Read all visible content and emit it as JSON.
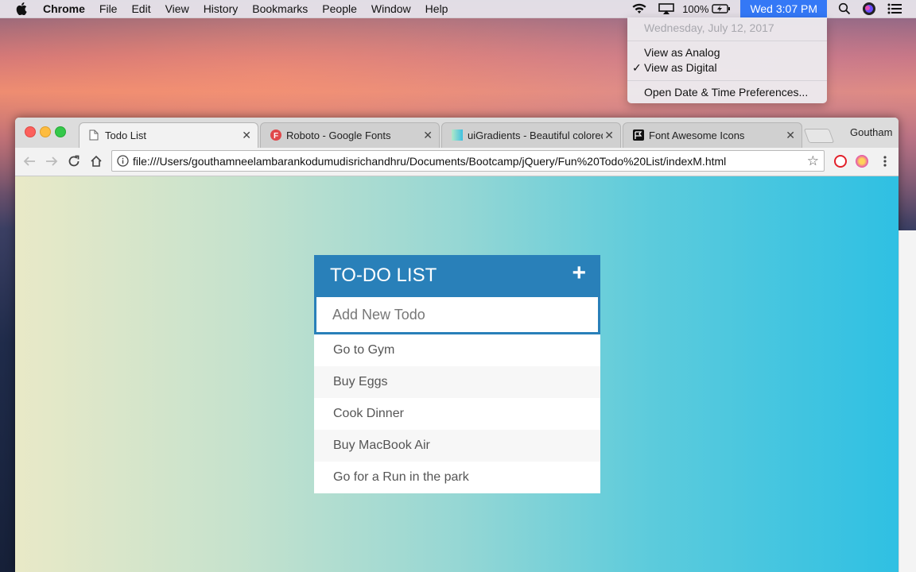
{
  "menubar": {
    "app_name": "Chrome",
    "menus": [
      "File",
      "Edit",
      "View",
      "History",
      "Bookmarks",
      "People",
      "Window",
      "Help"
    ],
    "battery": "100%",
    "clock": "Wed 3:07 PM",
    "icons": [
      "wifi-icon",
      "airplay-icon",
      "battery-icon",
      "spotlight-icon",
      "siri-icon",
      "notification-center-icon"
    ]
  },
  "clock_menu": {
    "date": "Wednesday, July 12, 2017",
    "view_analog": "View as Analog",
    "view_digital": "View as Digital",
    "check": "✓",
    "preferences": "Open Date & Time Preferences..."
  },
  "browser": {
    "tabs": [
      {
        "title": "Todo List",
        "active": true,
        "icon": "document-icon"
      },
      {
        "title": "Roboto - Google Fonts",
        "active": false,
        "icon": "google-fonts-icon"
      },
      {
        "title": "uiGradients - Beautiful colored",
        "active": false,
        "icon": "gradient-icon"
      },
      {
        "title": "Font Awesome Icons",
        "active": false,
        "icon": "flag-icon"
      }
    ],
    "close_glyph": "✕",
    "profile_name": "Goutham",
    "url": "file:///Users/gouthamneelambarankodumudisrichandhru/Documents/Bootcamp/jQuery/Fun%20Todo%20List/indexM.html",
    "star_glyph": "☆"
  },
  "todo": {
    "title": "TO-DO LIST",
    "add_glyph": "+",
    "input_placeholder": "Add New Todo",
    "items": [
      "Go to Gym",
      "Buy Eggs",
      "Cook Dinner",
      "Buy MacBook Air",
      "Go for a Run in the park"
    ]
  },
  "colors": {
    "header_blue": "#2980b9",
    "clock_highlight": "#3478f6"
  }
}
